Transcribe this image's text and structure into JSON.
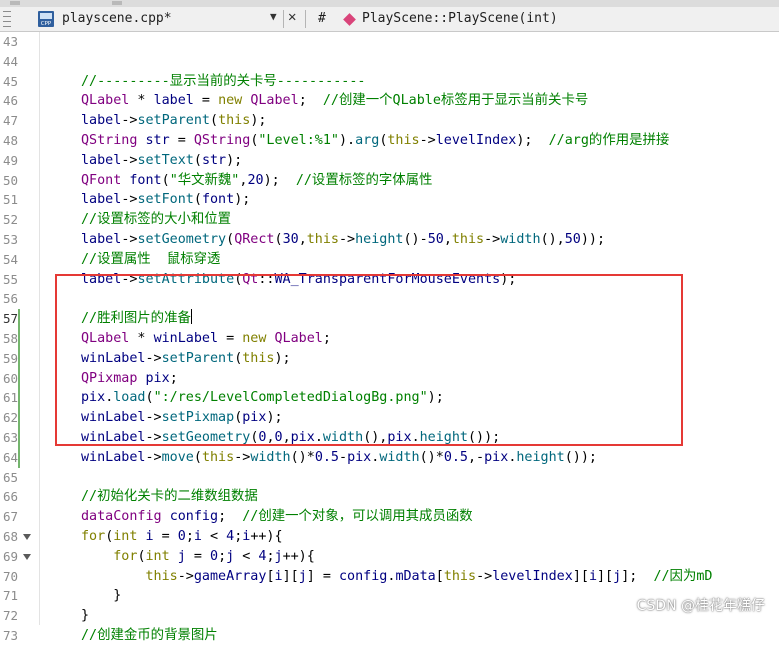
{
  "toolbar": {
    "file_name": "playscene.cpp*",
    "file_icon_label": "CPP",
    "dropdown_icon": "chevron-down-icon",
    "close_icon": "close-icon",
    "hash": "#",
    "symbol_icon": "method-icon",
    "symbol_name": "PlayScene::PlayScene(int)"
  },
  "editor": {
    "lines": [
      {
        "n": "43",
        "tokens": []
      },
      {
        "n": "44",
        "tokens": []
      },
      {
        "n": "45",
        "tokens": [
          [
            "com",
            "//---------显示当前的关卡号-----------"
          ]
        ]
      },
      {
        "n": "46",
        "tokens": [
          [
            "type",
            "QLabel"
          ],
          [
            "plain",
            " * "
          ],
          [
            "id",
            "label"
          ],
          [
            "plain",
            " = "
          ],
          [
            "kw",
            "new"
          ],
          [
            "plain",
            " "
          ],
          [
            "type",
            "QLabel"
          ],
          [
            "plain",
            ";  "
          ],
          [
            "com",
            "//创建一个QLable标签用于显示当前关卡号"
          ]
        ]
      },
      {
        "n": "47",
        "tokens": [
          [
            "id",
            "label"
          ],
          [
            "plain",
            "->"
          ],
          [
            "fn",
            "setParent"
          ],
          [
            "plain",
            "("
          ],
          [
            "kw",
            "this"
          ],
          [
            "plain",
            ");"
          ]
        ]
      },
      {
        "n": "48",
        "tokens": [
          [
            "type",
            "QString"
          ],
          [
            "plain",
            " "
          ],
          [
            "id",
            "str"
          ],
          [
            "plain",
            " = "
          ],
          [
            "type",
            "QString"
          ],
          [
            "plain",
            "("
          ],
          [
            "str",
            "\"Level:%1\""
          ],
          [
            "plain",
            ")."
          ],
          [
            "fn",
            "arg"
          ],
          [
            "plain",
            "("
          ],
          [
            "kw",
            "this"
          ],
          [
            "plain",
            "->"
          ],
          [
            "id",
            "levelIndex"
          ],
          [
            "plain",
            ");  "
          ],
          [
            "com",
            "//arg的作用是拼接"
          ]
        ]
      },
      {
        "n": "49",
        "tokens": [
          [
            "id",
            "label"
          ],
          [
            "plain",
            "->"
          ],
          [
            "fn",
            "setText"
          ],
          [
            "plain",
            "("
          ],
          [
            "id",
            "str"
          ],
          [
            "plain",
            ");"
          ]
        ]
      },
      {
        "n": "50",
        "tokens": [
          [
            "type",
            "QFont"
          ],
          [
            "plain",
            " "
          ],
          [
            "id",
            "font"
          ],
          [
            "plain",
            "("
          ],
          [
            "str",
            "\"华文新魏\""
          ],
          [
            "plain",
            ","
          ],
          [
            "num",
            "20"
          ],
          [
            "plain",
            ");  "
          ],
          [
            "com",
            "//设置标签的字体属性"
          ]
        ]
      },
      {
        "n": "51",
        "tokens": [
          [
            "id",
            "label"
          ],
          [
            "plain",
            "->"
          ],
          [
            "fn",
            "setFont"
          ],
          [
            "plain",
            "("
          ],
          [
            "id",
            "font"
          ],
          [
            "plain",
            ");"
          ]
        ]
      },
      {
        "n": "52",
        "tokens": [
          [
            "com",
            "//设置标签的大小和位置"
          ]
        ]
      },
      {
        "n": "53",
        "tokens": [
          [
            "id",
            "label"
          ],
          [
            "plain",
            "->"
          ],
          [
            "fn",
            "setGeometry"
          ],
          [
            "plain",
            "("
          ],
          [
            "type",
            "QRect"
          ],
          [
            "plain",
            "("
          ],
          [
            "num",
            "30"
          ],
          [
            "plain",
            ","
          ],
          [
            "kw",
            "this"
          ],
          [
            "plain",
            "->"
          ],
          [
            "fn",
            "height"
          ],
          [
            "plain",
            "()-"
          ],
          [
            "num",
            "50"
          ],
          [
            "plain",
            ","
          ],
          [
            "kw",
            "this"
          ],
          [
            "plain",
            "->"
          ],
          [
            "fn",
            "width"
          ],
          [
            "plain",
            "(),"
          ],
          [
            "num",
            "50"
          ],
          [
            "plain",
            "));"
          ]
        ]
      },
      {
        "n": "54",
        "tokens": [
          [
            "com",
            "//设置属性  鼠标穿透"
          ]
        ]
      },
      {
        "n": "55",
        "tokens": [
          [
            "id",
            "label"
          ],
          [
            "plain",
            "->"
          ],
          [
            "fn",
            "setAttribute"
          ],
          [
            "plain",
            "("
          ],
          [
            "type",
            "Qt"
          ],
          [
            "plain",
            "::"
          ],
          [
            "id",
            "WA_TransparentForMouseEvents"
          ],
          [
            "plain",
            ");"
          ]
        ]
      },
      {
        "n": "56",
        "tokens": []
      },
      {
        "n": "57",
        "tokens": [
          [
            "com",
            "//胜利图片的准备"
          ]
        ],
        "cursor": true
      },
      {
        "n": "58",
        "tokens": [
          [
            "type",
            "QLabel"
          ],
          [
            "plain",
            " * "
          ],
          [
            "id",
            "winLabel"
          ],
          [
            "plain",
            " = "
          ],
          [
            "kw",
            "new"
          ],
          [
            "plain",
            " "
          ],
          [
            "type",
            "QLabel"
          ],
          [
            "plain",
            ";"
          ]
        ]
      },
      {
        "n": "59",
        "tokens": [
          [
            "id",
            "winLabel"
          ],
          [
            "plain",
            "->"
          ],
          [
            "fn",
            "setParent"
          ],
          [
            "plain",
            "("
          ],
          [
            "kw",
            "this"
          ],
          [
            "plain",
            ");"
          ]
        ]
      },
      {
        "n": "60",
        "tokens": [
          [
            "type",
            "QPixmap"
          ],
          [
            "plain",
            " "
          ],
          [
            "id",
            "pix"
          ],
          [
            "plain",
            ";"
          ]
        ]
      },
      {
        "n": "61",
        "tokens": [
          [
            "id",
            "pix"
          ],
          [
            "plain",
            "."
          ],
          [
            "fn",
            "load"
          ],
          [
            "plain",
            "("
          ],
          [
            "str",
            "\":/res/LevelCompletedDialogBg.png\""
          ],
          [
            "plain",
            ");"
          ]
        ]
      },
      {
        "n": "62",
        "tokens": [
          [
            "id",
            "winLabel"
          ],
          [
            "plain",
            "->"
          ],
          [
            "fn",
            "setPixmap"
          ],
          [
            "plain",
            "("
          ],
          [
            "id",
            "pix"
          ],
          [
            "plain",
            ");"
          ]
        ]
      },
      {
        "n": "63",
        "tokens": [
          [
            "id",
            "winLabel"
          ],
          [
            "plain",
            "->"
          ],
          [
            "fn",
            "setGeometry"
          ],
          [
            "plain",
            "("
          ],
          [
            "num",
            "0"
          ],
          [
            "plain",
            ","
          ],
          [
            "num",
            "0"
          ],
          [
            "plain",
            ","
          ],
          [
            "id",
            "pix"
          ],
          [
            "plain",
            "."
          ],
          [
            "fn",
            "width"
          ],
          [
            "plain",
            "(),"
          ],
          [
            "id",
            "pix"
          ],
          [
            "plain",
            "."
          ],
          [
            "fn",
            "height"
          ],
          [
            "plain",
            "());"
          ]
        ]
      },
      {
        "n": "64",
        "tokens": [
          [
            "id",
            "winLabel"
          ],
          [
            "plain",
            "->"
          ],
          [
            "fn",
            "move"
          ],
          [
            "plain",
            "("
          ],
          [
            "kw",
            "this"
          ],
          [
            "plain",
            "->"
          ],
          [
            "fn",
            "width"
          ],
          [
            "plain",
            "()*"
          ],
          [
            "num",
            "0.5"
          ],
          [
            "plain",
            "-"
          ],
          [
            "id",
            "pix"
          ],
          [
            "plain",
            "."
          ],
          [
            "fn",
            "width"
          ],
          [
            "plain",
            "()*"
          ],
          [
            "num",
            "0.5"
          ],
          [
            "plain",
            ",-"
          ],
          [
            "id",
            "pix"
          ],
          [
            "plain",
            "."
          ],
          [
            "fn",
            "height"
          ],
          [
            "plain",
            "());"
          ]
        ]
      },
      {
        "n": "65",
        "tokens": []
      },
      {
        "n": "66",
        "tokens": [
          [
            "com",
            "//初始化关卡的二维数组数据"
          ]
        ]
      },
      {
        "n": "67",
        "tokens": [
          [
            "type",
            "dataConfig"
          ],
          [
            "plain",
            " "
          ],
          [
            "id",
            "config"
          ],
          [
            "plain",
            ";  "
          ],
          [
            "com",
            "//创建一个对象，可以调用其成员函数"
          ]
        ]
      },
      {
        "n": "68",
        "tokens": [
          [
            "kw",
            "for"
          ],
          [
            "plain",
            "("
          ],
          [
            "kw",
            "int"
          ],
          [
            "plain",
            " "
          ],
          [
            "id",
            "i"
          ],
          [
            "plain",
            " = "
          ],
          [
            "num",
            "0"
          ],
          [
            "plain",
            ";"
          ],
          [
            "id",
            "i"
          ],
          [
            "plain",
            " < "
          ],
          [
            "num",
            "4"
          ],
          [
            "plain",
            ";"
          ],
          [
            "id",
            "i"
          ],
          [
            "plain",
            "++){"
          ]
        ],
        "fold": true
      },
      {
        "n": "69",
        "tokens": [
          [
            "plain",
            "    "
          ],
          [
            "kw",
            "for"
          ],
          [
            "plain",
            "("
          ],
          [
            "kw",
            "int"
          ],
          [
            "plain",
            " "
          ],
          [
            "id",
            "j"
          ],
          [
            "plain",
            " = "
          ],
          [
            "num",
            "0"
          ],
          [
            "plain",
            ";"
          ],
          [
            "id",
            "j"
          ],
          [
            "plain",
            " < "
          ],
          [
            "num",
            "4"
          ],
          [
            "plain",
            ";"
          ],
          [
            "id",
            "j"
          ],
          [
            "plain",
            "++){"
          ]
        ],
        "fold": true
      },
      {
        "n": "70",
        "tokens": [
          [
            "plain",
            "        "
          ],
          [
            "kw",
            "this"
          ],
          [
            "plain",
            "->"
          ],
          [
            "id",
            "gameArray"
          ],
          [
            "plain",
            "["
          ],
          [
            "id",
            "i"
          ],
          [
            "plain",
            "]["
          ],
          [
            "id",
            "j"
          ],
          [
            "plain",
            "] = "
          ],
          [
            "id",
            "config"
          ],
          [
            "plain",
            "."
          ],
          [
            "id",
            "mData"
          ],
          [
            "plain",
            "["
          ],
          [
            "kw",
            "this"
          ],
          [
            "plain",
            "->"
          ],
          [
            "id",
            "levelIndex"
          ],
          [
            "plain",
            "]["
          ],
          [
            "id",
            "i"
          ],
          [
            "plain",
            "]["
          ],
          [
            "id",
            "j"
          ],
          [
            "plain",
            "];  "
          ],
          [
            "com",
            "//因为mD"
          ]
        ]
      },
      {
        "n": "71",
        "tokens": [
          [
            "plain",
            "    }"
          ]
        ]
      },
      {
        "n": "72",
        "tokens": [
          [
            "plain",
            "}"
          ]
        ]
      },
      {
        "n": "73",
        "tokens": [
          [
            "com",
            "//创建金币的背景图片"
          ]
        ]
      }
    ]
  },
  "watermark": "CSDN @桂花年糕仔"
}
